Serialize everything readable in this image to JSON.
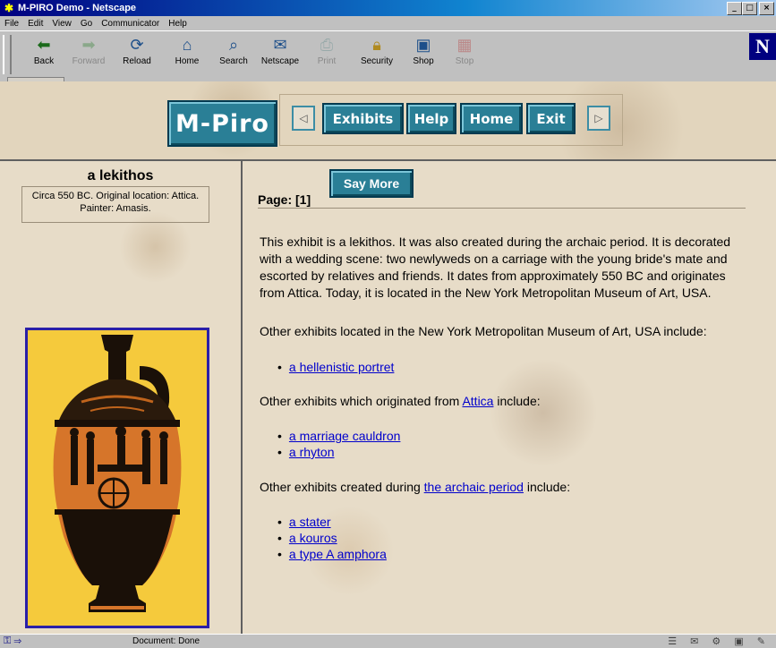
{
  "window": {
    "title": "M-PIRO Demo - Netscape",
    "buttons": [
      "_",
      "□",
      "×"
    ]
  },
  "menu": [
    "File",
    "Edit",
    "View",
    "Go",
    "Communicator",
    "Help"
  ],
  "toolbar": {
    "buttons": [
      {
        "label": "Back",
        "icon": "back-arrow-icon",
        "enabled": true
      },
      {
        "label": "Forward",
        "icon": "forward-arrow-icon",
        "enabled": false
      },
      {
        "label": "Reload",
        "icon": "reload-icon",
        "enabled": true
      },
      {
        "label": "Home",
        "icon": "home-icon",
        "enabled": true
      },
      {
        "label": "Search",
        "icon": "search-icon",
        "enabled": true
      },
      {
        "label": "Netscape",
        "icon": "netscape-icon",
        "enabled": true
      },
      {
        "label": "Print",
        "icon": "print-icon",
        "enabled": false
      },
      {
        "label": "Security",
        "icon": "lock-icon",
        "enabled": true
      },
      {
        "label": "Shop",
        "icon": "shop-icon",
        "enabled": true
      },
      {
        "label": "Stop",
        "icon": "stop-icon",
        "enabled": false
      }
    ],
    "brand": "N"
  },
  "nav": {
    "logo": "M-Piro",
    "prev": "◁",
    "next": "▷",
    "exhibits": "Exhibits",
    "help": "Help",
    "home": "Home",
    "exit": "Exit"
  },
  "exhibit": {
    "title": "a lekithos",
    "info": "Circa 550 BC. Original location: Attica. Painter: Amasis."
  },
  "main": {
    "page_label": "Page: [1]",
    "say_more": "Say More",
    "description": "This exhibit is a lekithos. It was also created during the archaic period. It is decorated with a wedding scene: two newlyweds on a carriage with the young bride's mate and escorted by relatives and friends. It dates from approximately 550 BC and originates from Attica. Today, it is located in the New York Metropolitan Museum of Art, USA.",
    "section1": {
      "text": "Other exhibits located in the New York Metropolitan Museum of Art, USA include:",
      "items": [
        "a hellenistic portret"
      ]
    },
    "section2": {
      "prefix": "Other exhibits which originated from ",
      "link": "Attica",
      "suffix": " include:",
      "items": [
        "a marriage cauldron",
        "a rhyton"
      ]
    },
    "section3": {
      "prefix": "Other exhibits created during ",
      "link": "the archaic period",
      "suffix": " include:",
      "items": [
        "a stater",
        "a kouros",
        "a type A amphora"
      ]
    }
  },
  "status": {
    "text": "Document: Done"
  },
  "colors": {
    "accent": "#2a7f96",
    "link": "#0000cc",
    "title_bar": "#000080",
    "vase_bg": "#f5ca3c"
  }
}
